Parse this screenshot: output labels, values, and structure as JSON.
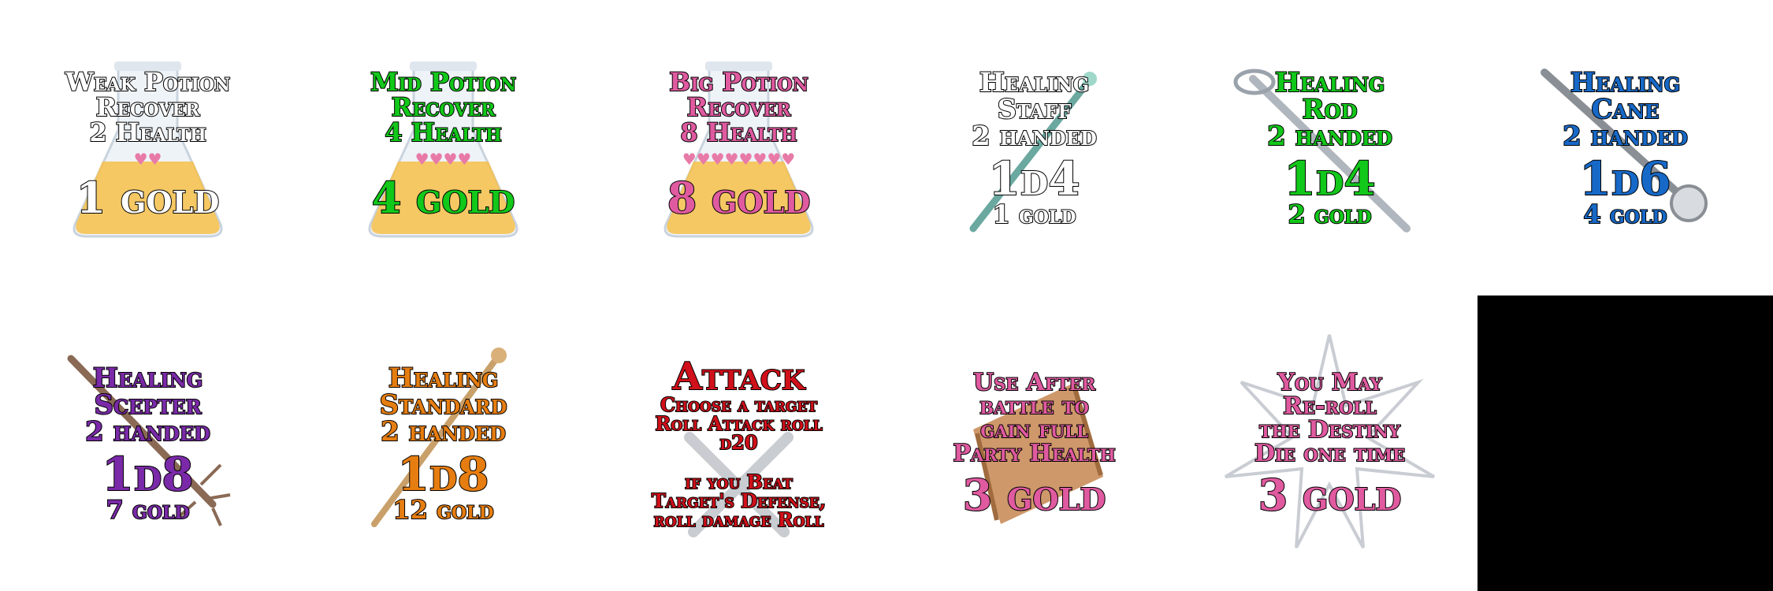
{
  "sheet_title": "",
  "colors": {
    "white": "#ffffff",
    "green": "#12c81a",
    "pink": "#e05aa0",
    "blue": "#1769c8",
    "purple": "#7a2aa8",
    "orange": "#e67d10",
    "red": "#d0101a",
    "black": "#000000"
  },
  "cards": {
    "weak_potion": {
      "line1": "Weak Potion",
      "line2": "Recover",
      "line3": "2 Health",
      "hearts": "♥♥",
      "cost": "1 gold",
      "icon": "potion-flask"
    },
    "mid_potion": {
      "line1": "Mid Potion",
      "line2": "Recover",
      "line3": "4 Health",
      "hearts": "♥♥♥♥",
      "cost": "4 gold",
      "icon": "potion-flask"
    },
    "big_potion": {
      "line1": "Big Potion",
      "line2": "Recover",
      "line3": "8 Health",
      "hearts": "♥♥♥♥♥♥♥♥",
      "cost": "8 gold",
      "icon": "potion-flask"
    },
    "healing_staff": {
      "line1": "Healing",
      "line2": "Staff",
      "line3": "2 handed",
      "die": "1d4",
      "cost": "1 gold",
      "icon": "staff"
    },
    "healing_rod": {
      "line1": "Healing",
      "line2": "Rod",
      "line3": "2 handed",
      "die": "1d4",
      "cost": "2 gold",
      "icon": "rod"
    },
    "healing_cane": {
      "line1": "Healing",
      "line2": "Cane",
      "line3": "2 handed",
      "die": "1d6",
      "cost": "4 gold",
      "icon": "cane"
    },
    "healing_scepter": {
      "line1": "Healing",
      "line2": "Scepter",
      "line3": "2 handed",
      "die": "1d8",
      "cost": "7 gold",
      "icon": "scepter"
    },
    "healing_standard": {
      "line1": "Healing",
      "line2": "Standard",
      "line3": "2 handed",
      "die": "1d8",
      "cost": "12 gold",
      "icon": "standard"
    },
    "attack": {
      "title": "Attack",
      "line1": "Choose a target",
      "line2": "Roll Attack roll",
      "line3": "d20",
      "line4": "if you Beat",
      "line5": "Target's Defense,",
      "line6": "roll damage Roll",
      "icon": "crossed-swords"
    },
    "party_heal": {
      "line1": "Use After",
      "line2": "battle to",
      "line3": "gain full",
      "line4": "Party Health",
      "cost": "3 gold",
      "icon": "scroll"
    },
    "reroll": {
      "line1": "You May",
      "line2": "Re-roll",
      "line3": "the Destiny",
      "line4": "Die one time",
      "cost": "3 gold",
      "icon": "star-burst"
    }
  }
}
